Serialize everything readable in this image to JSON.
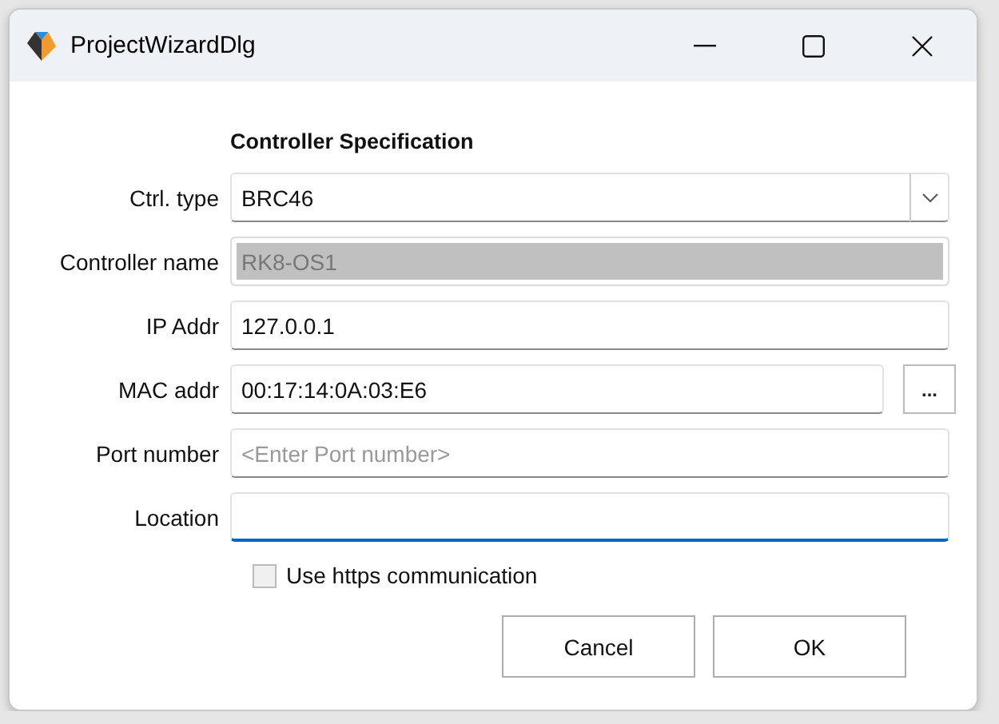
{
  "window": {
    "title": "ProjectWizardDlg"
  },
  "heading": "Controller Specification",
  "fields": [
    {
      "label": "Ctrl. type",
      "kind": "combo",
      "value": "BRC46",
      "disabled": false,
      "focused": false
    },
    {
      "label": "Controller name",
      "kind": "text",
      "value": "RK8-OS1",
      "disabled": true,
      "focused": false
    },
    {
      "label": "IP Addr",
      "kind": "text",
      "value": "127.0.0.1",
      "disabled": false,
      "focused": false
    },
    {
      "label": "MAC addr",
      "kind": "browse",
      "value": "00:17:14:0A:03:E6",
      "button": "...",
      "disabled": false,
      "focused": false
    },
    {
      "label": "Port number",
      "kind": "text",
      "placeholder": "<Enter Port number>",
      "disabled": false,
      "focused": false
    },
    {
      "label": "Location",
      "kind": "text",
      "disabled": false,
      "focused": true
    }
  ],
  "checkbox": {
    "label": "Use https communication",
    "checked": false
  },
  "buttons": [
    "Cancel",
    "OK"
  ]
}
